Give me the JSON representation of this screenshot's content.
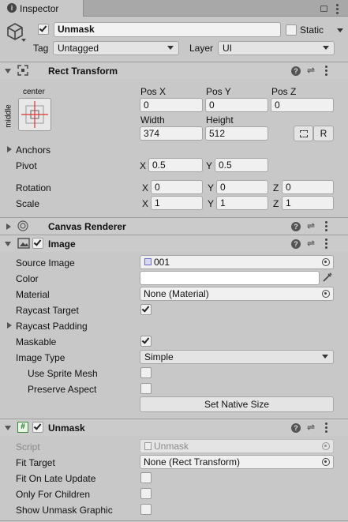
{
  "tab": {
    "label": "Inspector"
  },
  "object": {
    "name": "Unmask",
    "static_label": "Static",
    "tag_label": "Tag",
    "tag_value": "Untagged",
    "layer_label": "Layer",
    "layer_value": "UI"
  },
  "rect_transform": {
    "title": "Rect Transform",
    "anchor_top_label": "center",
    "anchor_side_label": "middle",
    "posx_label": "Pos X",
    "posx": "0",
    "posy_label": "Pos Y",
    "posy": "0",
    "posz_label": "Pos Z",
    "posz": "0",
    "width_label": "Width",
    "width": "374",
    "height_label": "Height",
    "height": "512",
    "r_button": "R",
    "anchors_label": "Anchors",
    "pivot_label": "Pivot",
    "pivot_x_label": "X",
    "pivot_x": "0.5",
    "pivot_y_label": "Y",
    "pivot_y": "0.5",
    "rotation_label": "Rotation",
    "rot_x_label": "X",
    "rot_x": "0",
    "rot_y_label": "Y",
    "rot_y": "0",
    "rot_z_label": "Z",
    "rot_z": "0",
    "scale_label": "Scale",
    "scale_x_label": "X",
    "scale_x": "1",
    "scale_y_label": "Y",
    "scale_y": "1",
    "scale_z_label": "Z",
    "scale_z": "1"
  },
  "canvas_renderer": {
    "title": "Canvas Renderer"
  },
  "image": {
    "title": "Image",
    "source_image_label": "Source Image",
    "source_image": "001",
    "color_label": "Color",
    "material_label": "Material",
    "material": "None (Material)",
    "raycast_target_label": "Raycast Target",
    "raycast_padding_label": "Raycast Padding",
    "maskable_label": "Maskable",
    "image_type_label": "Image Type",
    "image_type": "Simple",
    "use_sprite_mesh_label": "Use Sprite Mesh",
    "preserve_aspect_label": "Preserve Aspect",
    "set_native_size": "Set Native Size"
  },
  "unmask": {
    "title": "Unmask",
    "script_label": "Script",
    "script": "Unmask",
    "fit_target_label": "Fit Target",
    "fit_target": "None (Rect Transform)",
    "fit_on_late_update_label": "Fit On Late Update",
    "only_for_children_label": "Only For Children",
    "show_unmask_graphic_label": "Show Unmask Graphic"
  }
}
